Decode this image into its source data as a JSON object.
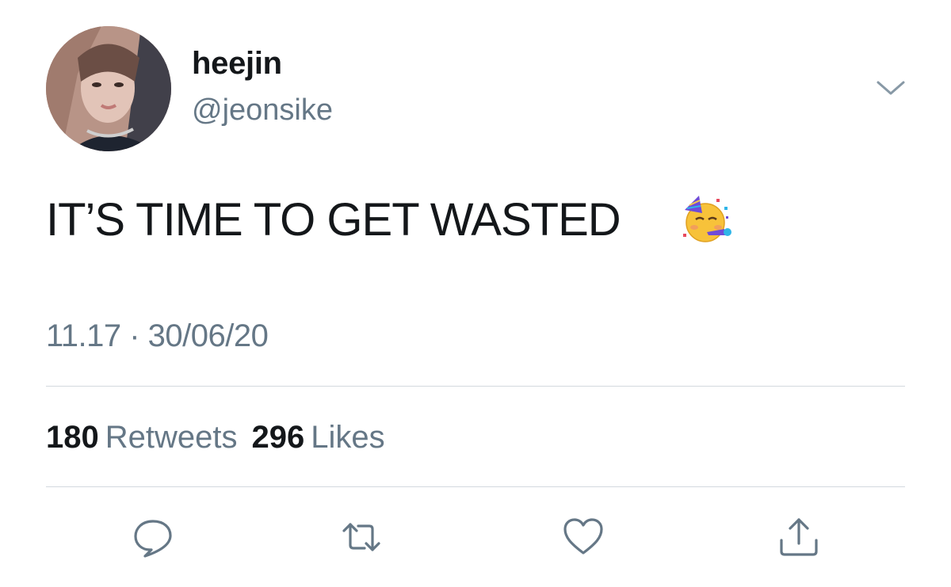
{
  "tweet": {
    "display_name": "heejin",
    "handle": "@jeonsike",
    "text": "IT’S TIME TO GET WASTED",
    "emoji": "partying-face",
    "timestamp": "11.17 · 30/06/20"
  },
  "stats": {
    "retweets_count": "180",
    "retweets_label": "Retweets",
    "likes_count": "296",
    "likes_label": "Likes"
  },
  "actions": [
    {
      "icon": "reply-icon"
    },
    {
      "icon": "retweet-icon"
    },
    {
      "icon": "like-icon"
    },
    {
      "icon": "share-icon"
    }
  ],
  "colors": {
    "text_primary": "#14171a",
    "text_secondary": "#657786",
    "divider": "#d3d9de",
    "icon": "#657786"
  }
}
